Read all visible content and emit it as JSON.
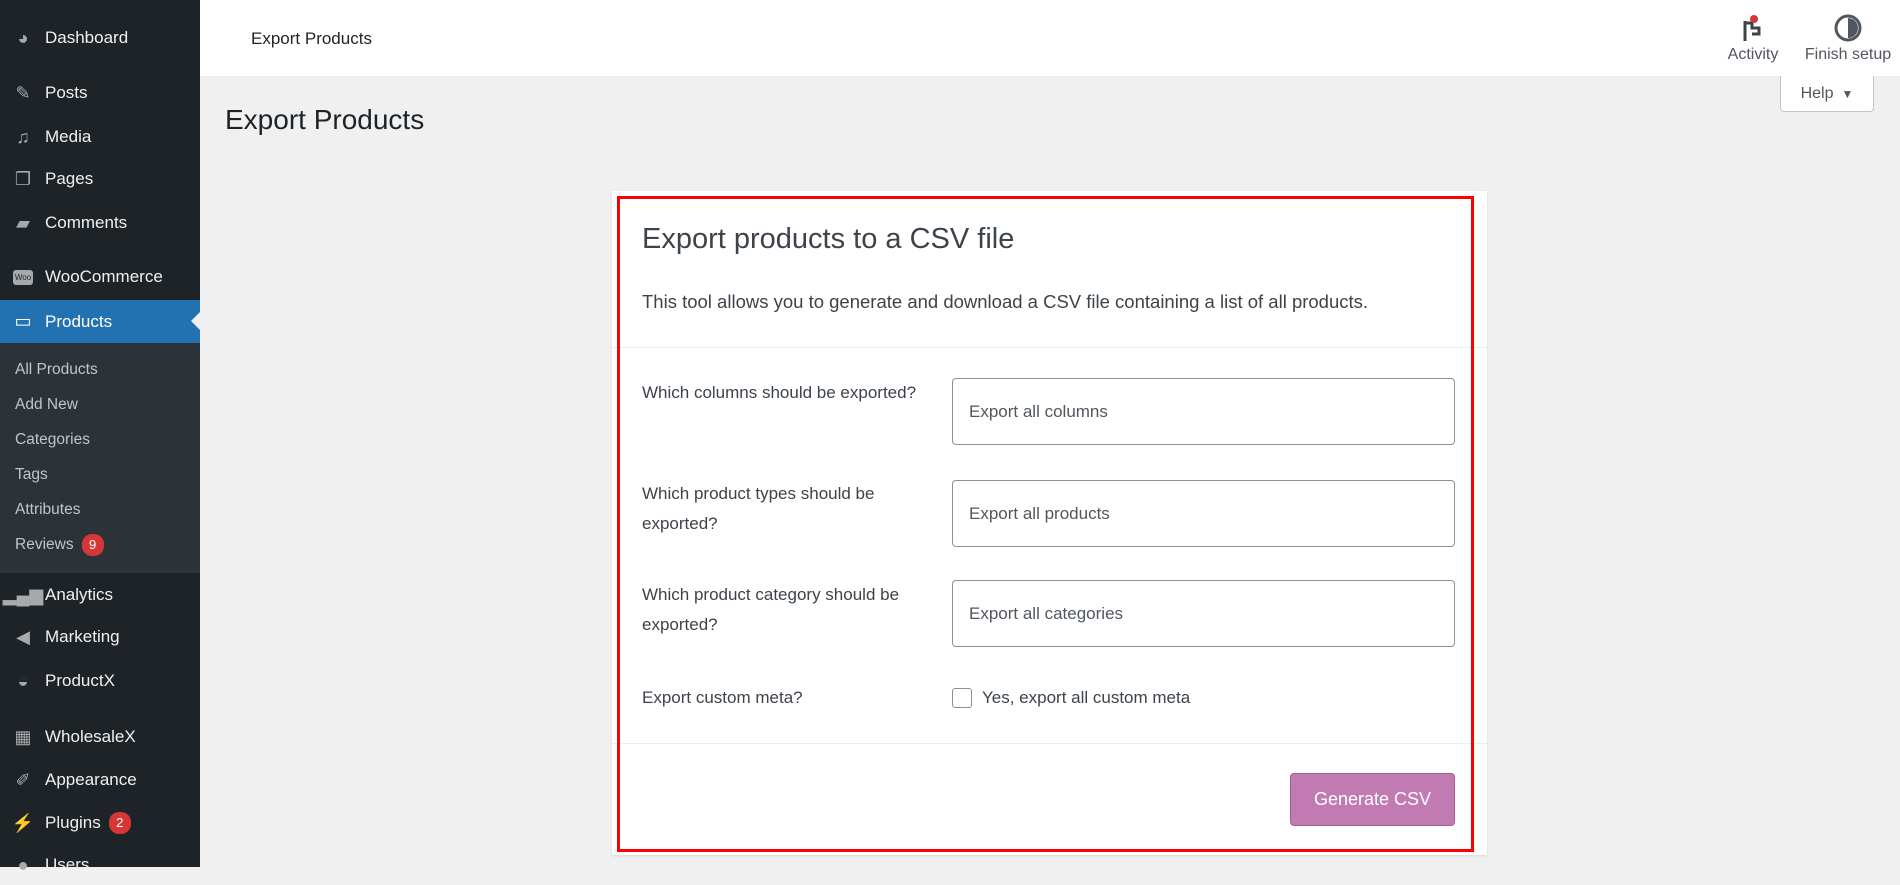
{
  "sidebar": {
    "items": [
      {
        "label": "Dashboard",
        "icon": "dashboard-icon"
      },
      {
        "label": "Posts",
        "icon": "pin-icon"
      },
      {
        "label": "Media",
        "icon": "media-icon"
      },
      {
        "label": "Pages",
        "icon": "pages-icon"
      },
      {
        "label": "Comments",
        "icon": "comment-icon"
      },
      {
        "label": "WooCommerce",
        "icon": "woo-icon"
      },
      {
        "label": "Products",
        "icon": "archive-icon"
      },
      {
        "label": "Analytics",
        "icon": "bar-chart-icon"
      },
      {
        "label": "Marketing",
        "icon": "megaphone-icon"
      },
      {
        "label": "ProductX",
        "icon": "basket-icon"
      },
      {
        "label": "WholesaleX",
        "icon": "cart-icon"
      },
      {
        "label": "Appearance",
        "icon": "brush-icon"
      },
      {
        "label": "Plugins",
        "icon": "plugin-icon",
        "badge": "2"
      },
      {
        "label": "Users",
        "icon": "user-icon"
      }
    ],
    "submenu": [
      {
        "label": "All Products"
      },
      {
        "label": "Add New"
      },
      {
        "label": "Categories"
      },
      {
        "label": "Tags"
      },
      {
        "label": "Attributes"
      },
      {
        "label": "Reviews",
        "badge": "9"
      }
    ]
  },
  "topbar": {
    "title": "Export Products",
    "activity": "Activity",
    "finish_setup": "Finish setup",
    "help": "Help"
  },
  "page_title": "Export Products",
  "card": {
    "title": "Export products to a CSV file",
    "description": "This tool allows you to generate and download a CSV file containing a list of all products.",
    "rows": [
      {
        "label": "Which columns should be exported?",
        "placeholder": "Export all columns"
      },
      {
        "label": "Which product types should be exported?",
        "placeholder": "Export all products"
      },
      {
        "label": "Which product category should be exported?",
        "placeholder": "Export all categories"
      }
    ],
    "meta_label": "Export custom meta?",
    "meta_checkbox": "Yes, export all custom meta",
    "meta_checked": false,
    "button": "Generate CSV"
  },
  "colors": {
    "accent": "#2271b1",
    "button": "#c17ab2",
    "highlight": "#ff0000",
    "badge": "#d63638"
  }
}
